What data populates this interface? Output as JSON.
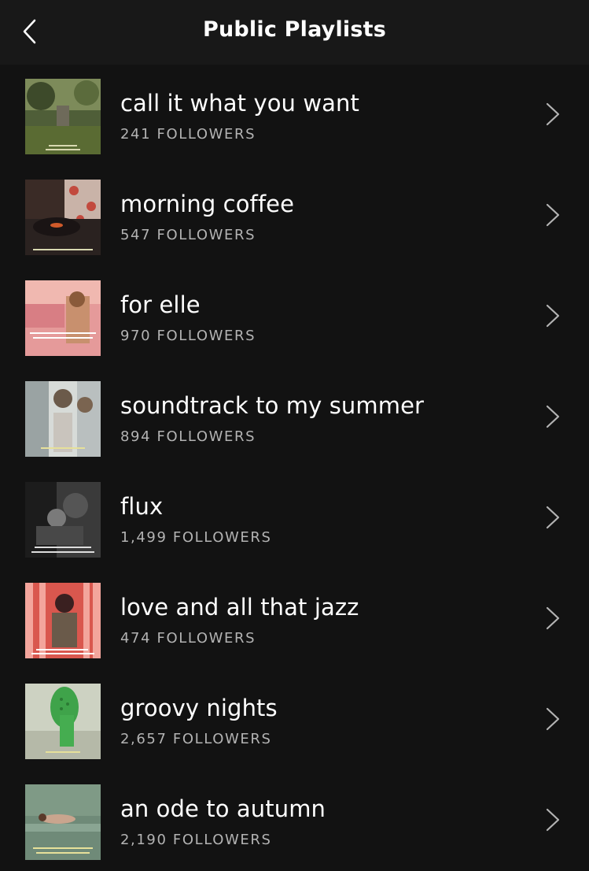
{
  "header": {
    "title": "Public Playlists",
    "back_icon": "chevron-left-icon"
  },
  "followers_suffix": "FOLLOWERS",
  "playlists": [
    {
      "title": "call it what you want",
      "followers": "241",
      "cover": "cover-image"
    },
    {
      "title": "morning coffee",
      "followers": "547",
      "cover": "cover-image"
    },
    {
      "title": "for elle",
      "followers": "970",
      "cover": "cover-image"
    },
    {
      "title": "soundtrack to my summer",
      "followers": "894",
      "cover": "cover-image"
    },
    {
      "title": "flux",
      "followers": "1,499",
      "cover": "cover-image"
    },
    {
      "title": "love and all that jazz",
      "followers": "474",
      "cover": "cover-image"
    },
    {
      "title": "groovy nights",
      "followers": "2,657",
      "cover": "cover-image"
    },
    {
      "title": "an ode to autumn",
      "followers": "2,190",
      "cover": "cover-image"
    }
  ],
  "colors": {
    "background": "#121212",
    "header_background": "#181818",
    "primary_text": "#ffffff",
    "secondary_text": "#b3b3b3"
  }
}
